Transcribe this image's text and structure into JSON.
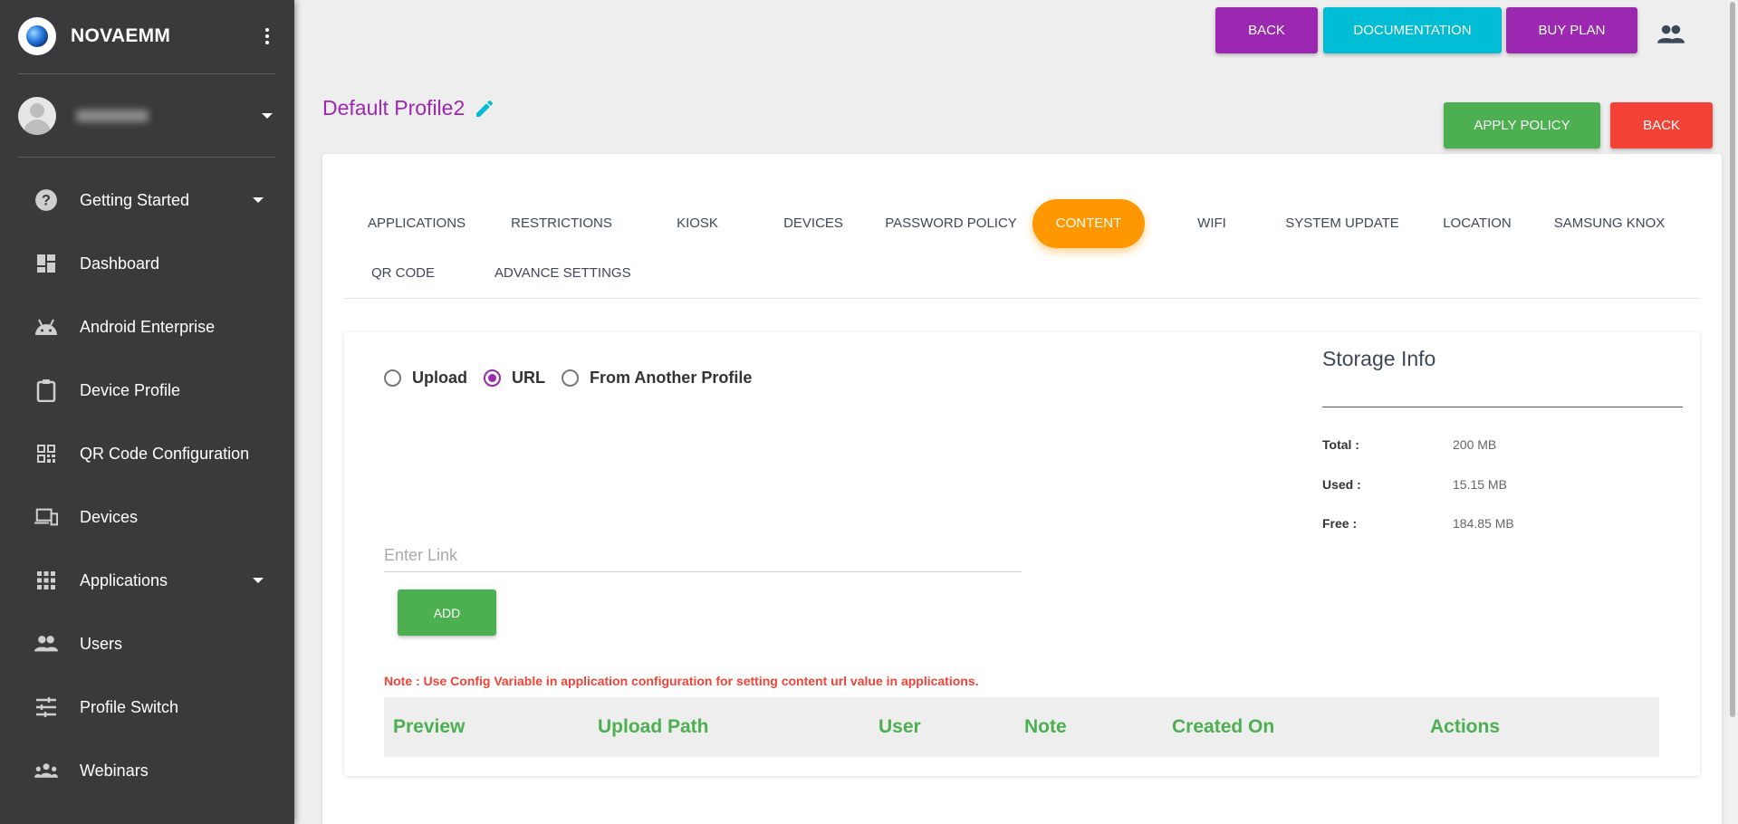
{
  "app": {
    "brand": "NOVAEMM"
  },
  "sidebar": {
    "items": [
      {
        "label": "Getting Started",
        "icon": "help-circle-icon"
      },
      {
        "label": "Dashboard",
        "icon": "dashboard-icon"
      },
      {
        "label": "Android Enterprise",
        "icon": "android-icon"
      },
      {
        "label": "Device Profile",
        "icon": "clipboard-icon"
      },
      {
        "label": "QR Code Configuration",
        "icon": "qr-code-icon"
      },
      {
        "label": "Devices",
        "icon": "devices-icon"
      },
      {
        "label": "Applications",
        "icon": "apps-grid-icon"
      },
      {
        "label": "Users",
        "icon": "users-icon"
      },
      {
        "label": "Profile Switch",
        "icon": "tune-icon"
      },
      {
        "label": "Webinars",
        "icon": "groups-icon"
      }
    ]
  },
  "topbar": {
    "back_label": "BACK",
    "documentation_label": "DOCUMENTATION",
    "buy_plan_label": "BUY PLAN",
    "back_color": "#9c27b0",
    "documentation_color": "#00bcd4",
    "buy_plan_color": "#9c27b0"
  },
  "page": {
    "title": "Default Profile2",
    "apply_policy_label": "APPLY POLICY",
    "back_label": "BACK",
    "apply_color": "#4caf50",
    "back_color": "#f44336"
  },
  "tabs": [
    {
      "label": "APPLICATIONS"
    },
    {
      "label": "RESTRICTIONS"
    },
    {
      "label": "KIOSK"
    },
    {
      "label": "DEVICES"
    },
    {
      "label": "PASSWORD POLICY"
    },
    {
      "label": "CONTENT",
      "active": true
    },
    {
      "label": "WIFI"
    },
    {
      "label": "SYSTEM UPDATE"
    },
    {
      "label": "LOCATION"
    },
    {
      "label": "SAMSUNG KNOX"
    },
    {
      "label": "QR CODE"
    },
    {
      "label": "ADVANCE SETTINGS"
    }
  ],
  "content": {
    "radio_options": [
      {
        "label": "Upload",
        "selected": false
      },
      {
        "label": "URL",
        "selected": true
      },
      {
        "label": "From Another Profile",
        "selected": false
      }
    ],
    "link_placeholder": "Enter Link",
    "link_value": "",
    "add_label": "ADD",
    "note": "Note : Use Config Variable in application configuration for setting content url value in applications.",
    "table_headers": [
      "Preview",
      "Upload Path",
      "User",
      "Note",
      "Created On",
      "Actions"
    ]
  },
  "storage": {
    "title": "Storage Info",
    "rows": [
      {
        "label": "Total :",
        "value": "200 MB"
      },
      {
        "label": "Used :",
        "value": "15.15 MB"
      },
      {
        "label": "Free :",
        "value": "184.85 MB"
      }
    ]
  },
  "colors": {
    "sidebar_bg": "#3a3a3c",
    "accent_purple": "#9c27b0",
    "active_tab": "#ff9800",
    "table_header_text": "#4caf50",
    "note_text": "#f44336"
  }
}
